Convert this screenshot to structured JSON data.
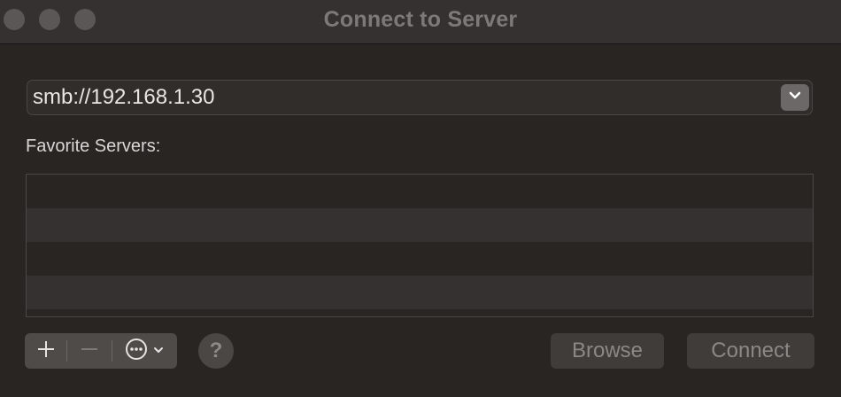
{
  "window": {
    "title": "Connect to Server"
  },
  "address": {
    "value": "smb://192.168.1.30",
    "dropdown_icon": "chevron-down-icon"
  },
  "favorites": {
    "label": "Favorite Servers:",
    "items": []
  },
  "toolbar": {
    "add_icon": "plus-icon",
    "remove_icon": "minus-icon",
    "more_icon": "ellipsis-circle-icon",
    "help_label": "?",
    "browse_label": "Browse",
    "connect_label": "Connect"
  },
  "colors": {
    "background": "#282523",
    "titlebar": "#343130",
    "text": "#e9e6e4",
    "disabled_text": "#8b8886"
  }
}
